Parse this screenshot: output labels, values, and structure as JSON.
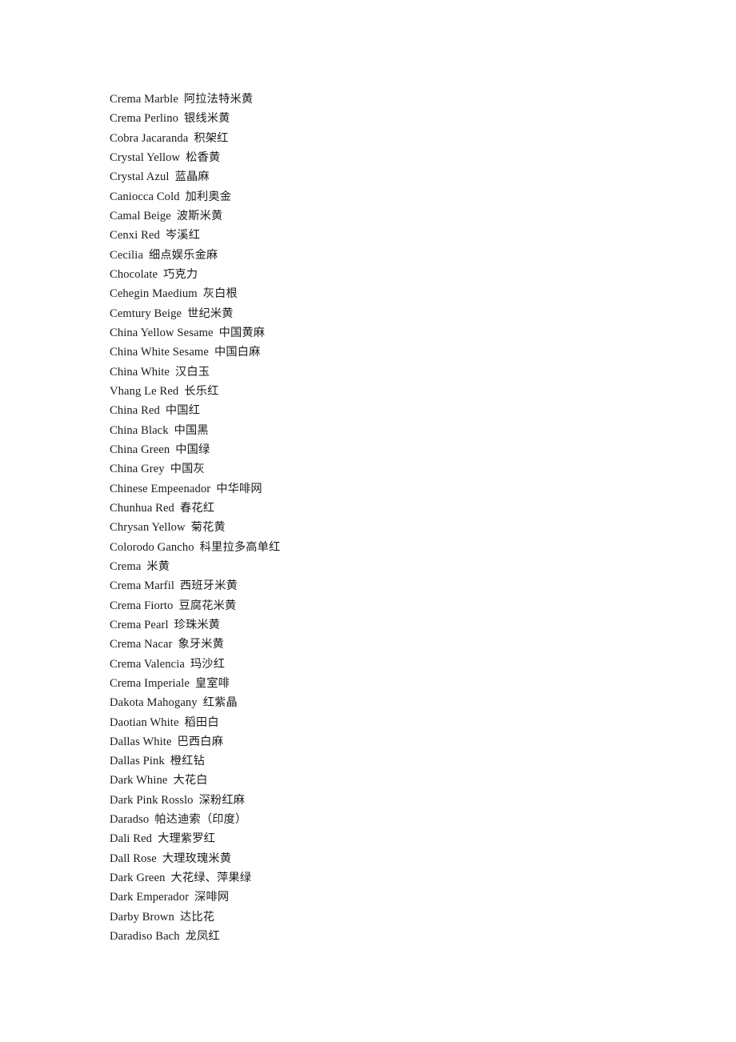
{
  "document": {
    "page_background": "#ffffff",
    "text_color": "#1b1b1b",
    "entries": [
      {
        "en": "Crema Marble",
        "zh": "阿拉法特米黄"
      },
      {
        "en": "Crema Perlino",
        "zh": "银线米黄"
      },
      {
        "en": "Cobra Jacaranda",
        "zh": "积架红"
      },
      {
        "en": "Crystal Yellow",
        "zh": "松香黄"
      },
      {
        "en": "Crystal Azul",
        "zh": "蓝晶麻"
      },
      {
        "en": "Caniocca Cold",
        "zh": "加利奥金"
      },
      {
        "en": "Camal Beige",
        "zh": "波斯米黄"
      },
      {
        "en": "Cenxi Red",
        "zh": "岑溪红"
      },
      {
        "en": "Cecilia",
        "zh": "细点娱乐金麻"
      },
      {
        "en": "Chocolate",
        "zh": "巧克力"
      },
      {
        "en": "Cehegin Maedium",
        "zh": "灰白根"
      },
      {
        "en": "Cemtury Beige",
        "zh": "世纪米黄"
      },
      {
        "en": "China Yellow Sesame",
        "zh": "中国黄麻"
      },
      {
        "en": "China White Sesame",
        "zh": "中国白麻"
      },
      {
        "en": "China White",
        "zh": "汉白玉"
      },
      {
        "en": "Vhang Le Red",
        "zh": "长乐红"
      },
      {
        "en": "China Red",
        "zh": "中国红"
      },
      {
        "en": "China Black",
        "zh": "中国黑"
      },
      {
        "en": "China Green",
        "zh": "中国绿"
      },
      {
        "en": "China Grey",
        "zh": "中国灰"
      },
      {
        "en": "Chinese Empeenador",
        "zh": "中华啡网"
      },
      {
        "en": "Chunhua Red",
        "zh": "春花红"
      },
      {
        "en": "Chrysan Yellow",
        "zh": "菊花黄"
      },
      {
        "en": "Colorodo Gancho",
        "zh": "科里拉多高单红"
      },
      {
        "en": "Crema",
        "zh": "米黄"
      },
      {
        "en": "Crema Marfil",
        "zh": "西班牙米黄"
      },
      {
        "en": "Crema Fiorto",
        "zh": "豆腐花米黄"
      },
      {
        "en": "Crema Pearl",
        "zh": "珍珠米黄"
      },
      {
        "en": "Crema Nacar",
        "zh": "象牙米黄"
      },
      {
        "en": "Crema Valencia",
        "zh": "玛沙红"
      },
      {
        "en": "Crema Imperiale",
        "zh": "皇室啡"
      },
      {
        "en": "Dakota Mahogany",
        "zh": "红紫晶"
      },
      {
        "en": "Daotian White",
        "zh": "稻田白"
      },
      {
        "en": "Dallas White",
        "zh": "巴西白麻"
      },
      {
        "en": "Dallas Pink",
        "zh": "橙红钻"
      },
      {
        "en": "Dark Whine",
        "zh": "大花白"
      },
      {
        "en": "Dark Pink Rosslo",
        "zh": "深粉红麻"
      },
      {
        "en": "Daradso",
        "zh": "帕达迪索（印度）"
      },
      {
        "en": "Dali Red",
        "zh": "大理紫罗红"
      },
      {
        "en": "Dall Rose",
        "zh": "大理玫瑰米黄"
      },
      {
        "en": "Dark Green",
        "zh": "大花绿、萍果绿"
      },
      {
        "en": "Dark Emperador",
        "zh": "深啡网"
      },
      {
        "en": "Darby Brown",
        "zh": "达比花"
      },
      {
        "en": "Daradiso Bach",
        "zh": "龙凤红"
      }
    ]
  }
}
